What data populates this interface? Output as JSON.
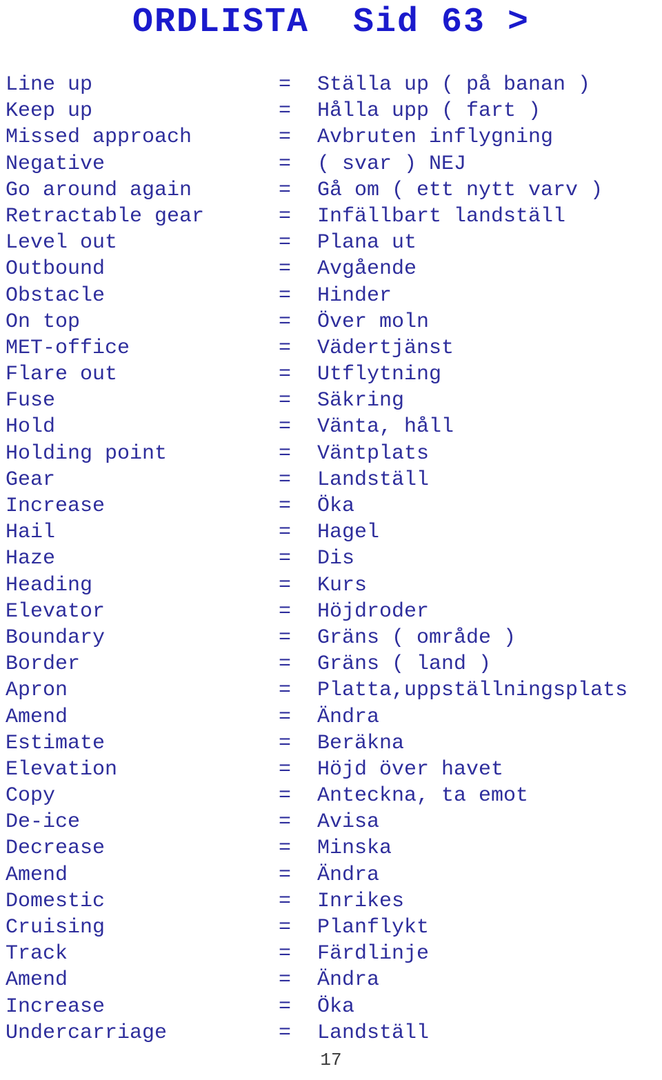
{
  "document": {
    "title": "ORDLISTA  Sid 63 >",
    "page_number": "17",
    "title_color": "#1a1acc",
    "body_color": "#2e2e9c",
    "page_number_color": "#3a3a3a",
    "background_color": "#ffffff",
    "separator": "="
  },
  "glossary": {
    "entries": [
      {
        "en": "Line up",
        "eq": "=",
        "sv": "Ställa up ( på banan )"
      },
      {
        "en": "Keep up",
        "eq": "=",
        "sv": "Hålla upp ( fart )"
      },
      {
        "en": "Missed approach",
        "eq": "=",
        "sv": "Avbruten inflygning"
      },
      {
        "en": "Negative",
        "eq": "=",
        "sv": "( svar ) NEJ"
      },
      {
        "en": "Go around again",
        "eq": "=",
        "sv": "Gå om ( ett nytt varv )"
      },
      {
        "en": "Retractable gear",
        "eq": "=",
        "sv": "Infällbart landställ"
      },
      {
        "en": "Level out",
        "eq": "=",
        "sv": "Plana ut"
      },
      {
        "en": "Outbound",
        "eq": "=",
        "sv": "Avgående"
      },
      {
        "en": "Obstacle",
        "eq": "=",
        "sv": "Hinder"
      },
      {
        "en": "On top",
        "eq": "=",
        "sv": "Över moln"
      },
      {
        "en": "MET-office",
        "eq": "=",
        "sv": "Vädertjänst"
      },
      {
        "en": "Flare out",
        "eq": "=",
        "sv": "Utflytning"
      },
      {
        "en": "Fuse",
        "eq": "=",
        "sv": "Säkring"
      },
      {
        "en": "Hold",
        "eq": "=",
        "sv": "Vänta, håll"
      },
      {
        "en": "Holding point",
        "eq": "=",
        "sv": "Väntplats"
      },
      {
        "en": "Gear",
        "eq": "=",
        "sv": "Landställ"
      },
      {
        "en": "Increase",
        "eq": "=",
        "sv": "Öka"
      },
      {
        "en": "Hail",
        "eq": "=",
        "sv": "Hagel"
      },
      {
        "en": "Haze",
        "eq": "=",
        "sv": "Dis"
      },
      {
        "en": "Heading",
        "eq": "=",
        "sv": "Kurs"
      },
      {
        "en": "Elevator",
        "eq": "=",
        "sv": "Höjdroder"
      },
      {
        "en": "Boundary",
        "eq": "=",
        "sv": "Gräns ( område )"
      },
      {
        "en": "Border",
        "eq": "=",
        "sv": "Gräns ( land )"
      },
      {
        "en": "Apron",
        "eq": "=",
        "sv": "Platta,uppställningsplats"
      },
      {
        "en": "Amend",
        "eq": "=",
        "sv": "Ändra"
      },
      {
        "en": "Estimate",
        "eq": "=",
        "sv": "Beräkna"
      },
      {
        "en": "Elevation",
        "eq": "=",
        "sv": "Höjd över havet"
      },
      {
        "en": "Copy",
        "eq": "=",
        "sv": "Anteckna, ta emot"
      },
      {
        "en": "De-ice",
        "eq": "=",
        "sv": "Avisa"
      },
      {
        "en": "Decrease",
        "eq": "=",
        "sv": "Minska"
      },
      {
        "en": "Amend",
        "eq": "=",
        "sv": "Ändra"
      },
      {
        "en": "Domestic",
        "eq": "=",
        "sv": "Inrikes"
      },
      {
        "en": "Cruising",
        "eq": "=",
        "sv": "Planflykt"
      },
      {
        "en": "Track",
        "eq": "=",
        "sv": "Färdlinje"
      },
      {
        "en": "Amend",
        "eq": "=",
        "sv": "Ändra"
      },
      {
        "en": "Increase",
        "eq": "=",
        "sv": "Öka"
      },
      {
        "en": "Undercarriage",
        "eq": "=",
        "sv": "Landställ"
      }
    ]
  }
}
